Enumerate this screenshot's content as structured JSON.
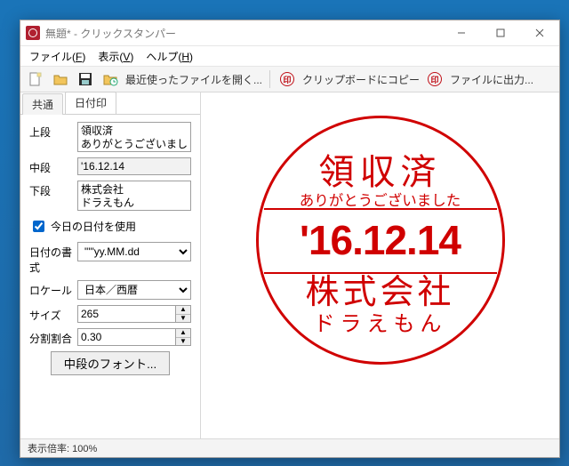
{
  "window": {
    "title": "無題* - クリックスタンパー"
  },
  "menu": {
    "file": "ファイル(",
    "file_u": "F",
    "file_end": ")",
    "view": "表示(",
    "view_u": "V",
    "view_end": ")",
    "help": "ヘルプ(",
    "help_u": "H",
    "help_end": ")"
  },
  "toolbar": {
    "recent": "最近使ったファイルを開く...",
    "copy": "クリップボードにコピー",
    "output": "ファイルに出力..."
  },
  "tabs": {
    "common": "共通",
    "date": "日付印"
  },
  "form": {
    "top_label": "上段",
    "top_value": "領収済\nありがとうございました",
    "mid_label": "中段",
    "mid_value": "'16.12.14",
    "bot_label": "下段",
    "bot_value": "株式会社\nドラえもん",
    "use_today": "今日の日付を使用",
    "date_format_label": "日付の書式",
    "date_format_value": "\"'\"yy.MM.dd",
    "locale_label": "ロケール",
    "locale_value": "日本／西暦",
    "size_label": "サイズ",
    "size_value": "265",
    "ratio_label": "分割割合",
    "ratio_value": "0.30",
    "font_btn": "中段のフォント..."
  },
  "stamp": {
    "top1": "領収済",
    "top2": "ありがとうございました",
    "mid": "'16.12.14",
    "bot1": "株式会社",
    "bot2": "ドラえもん"
  },
  "status": {
    "zoom": "表示倍率: 100%"
  },
  "colors": {
    "accent": "#d00000"
  }
}
